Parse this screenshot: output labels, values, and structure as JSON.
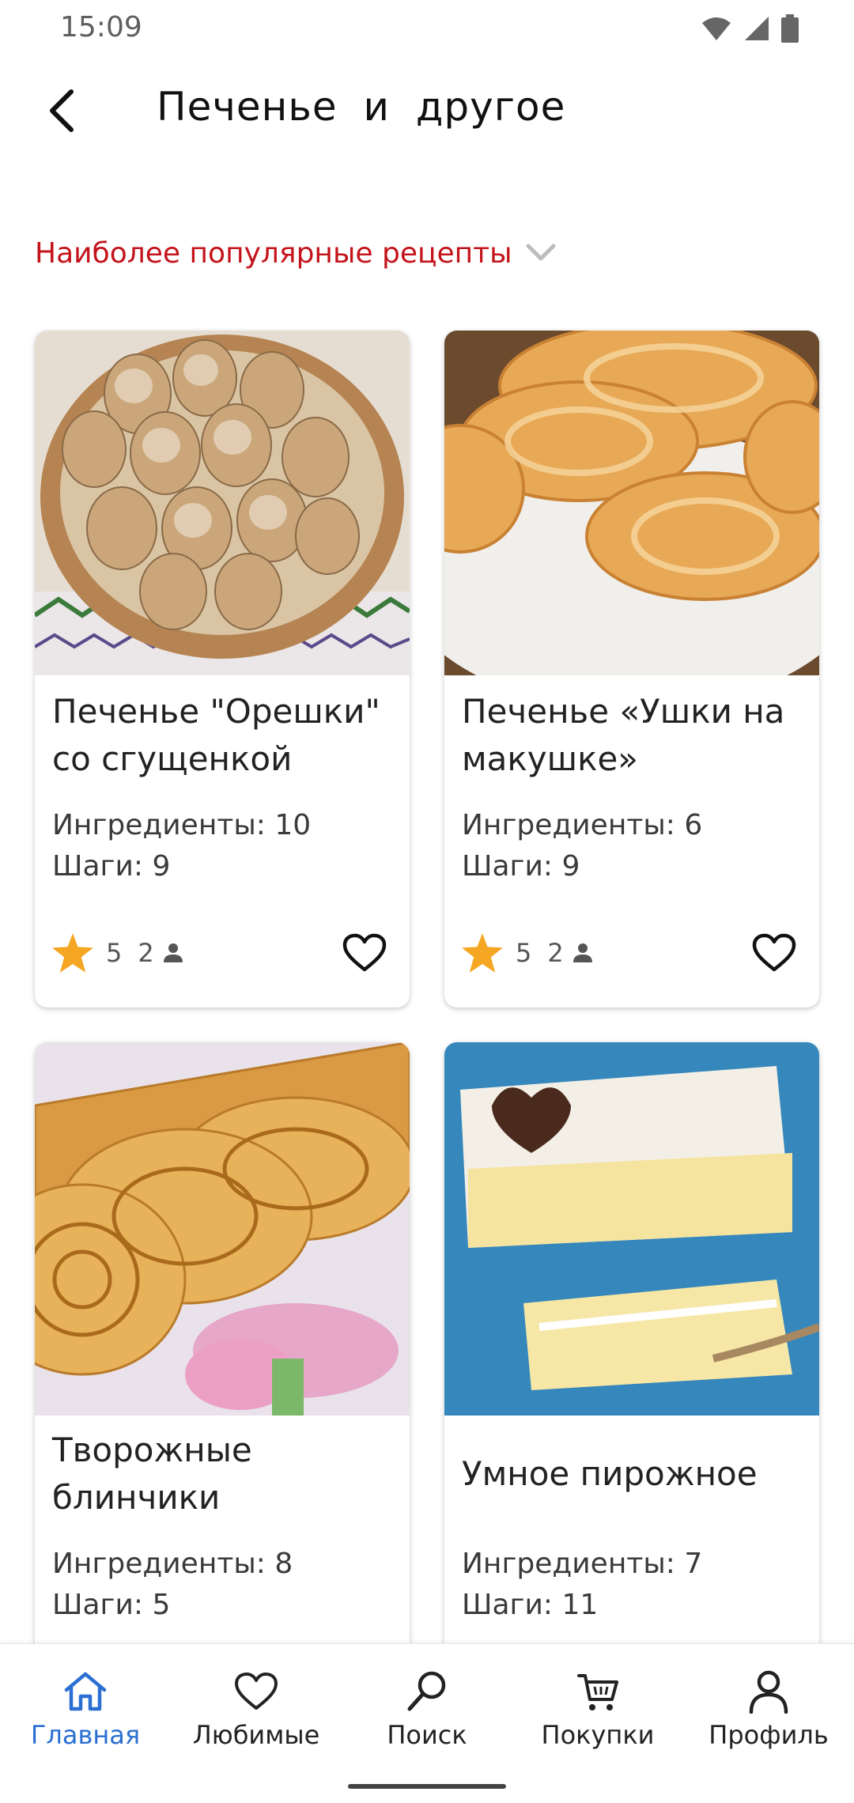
{
  "status_bar": {
    "time": "15:09"
  },
  "header": {
    "title": "Печенье и другое"
  },
  "sort": {
    "label": "Наиболее популярные рецепты"
  },
  "colors": {
    "accent_red": "#c4131b",
    "nav_active": "#2a6fd1",
    "star": "#f5a623"
  },
  "recipes": [
    {
      "title": "Печенье \"Орешки\" со сгущенкой",
      "ingredients": "Ингредиенты: 10",
      "steps": "Шаги: 9",
      "rating": "5",
      "reviews": "2"
    },
    {
      "title": "Печенье «Ушки на макушке»",
      "ingredients": "Ингредиенты: 6",
      "steps": "Шаги: 9",
      "rating": "5",
      "reviews": "2"
    },
    {
      "title": "Творожные блинчики",
      "ingredients": "Ингредиенты: 8",
      "steps": "Шаги: 5"
    },
    {
      "title": "Умное пирожное",
      "ingredients": "Ингредиенты: 7",
      "steps": "Шаги: 11"
    }
  ],
  "nav": [
    {
      "label": "Главная",
      "icon": "home-icon",
      "active": true
    },
    {
      "label": "Любимые",
      "icon": "heart-icon"
    },
    {
      "label": "Поиск",
      "icon": "search-icon"
    },
    {
      "label": "Покупки",
      "icon": "cart-icon"
    },
    {
      "label": "Профиль",
      "icon": "profile-icon"
    }
  ]
}
